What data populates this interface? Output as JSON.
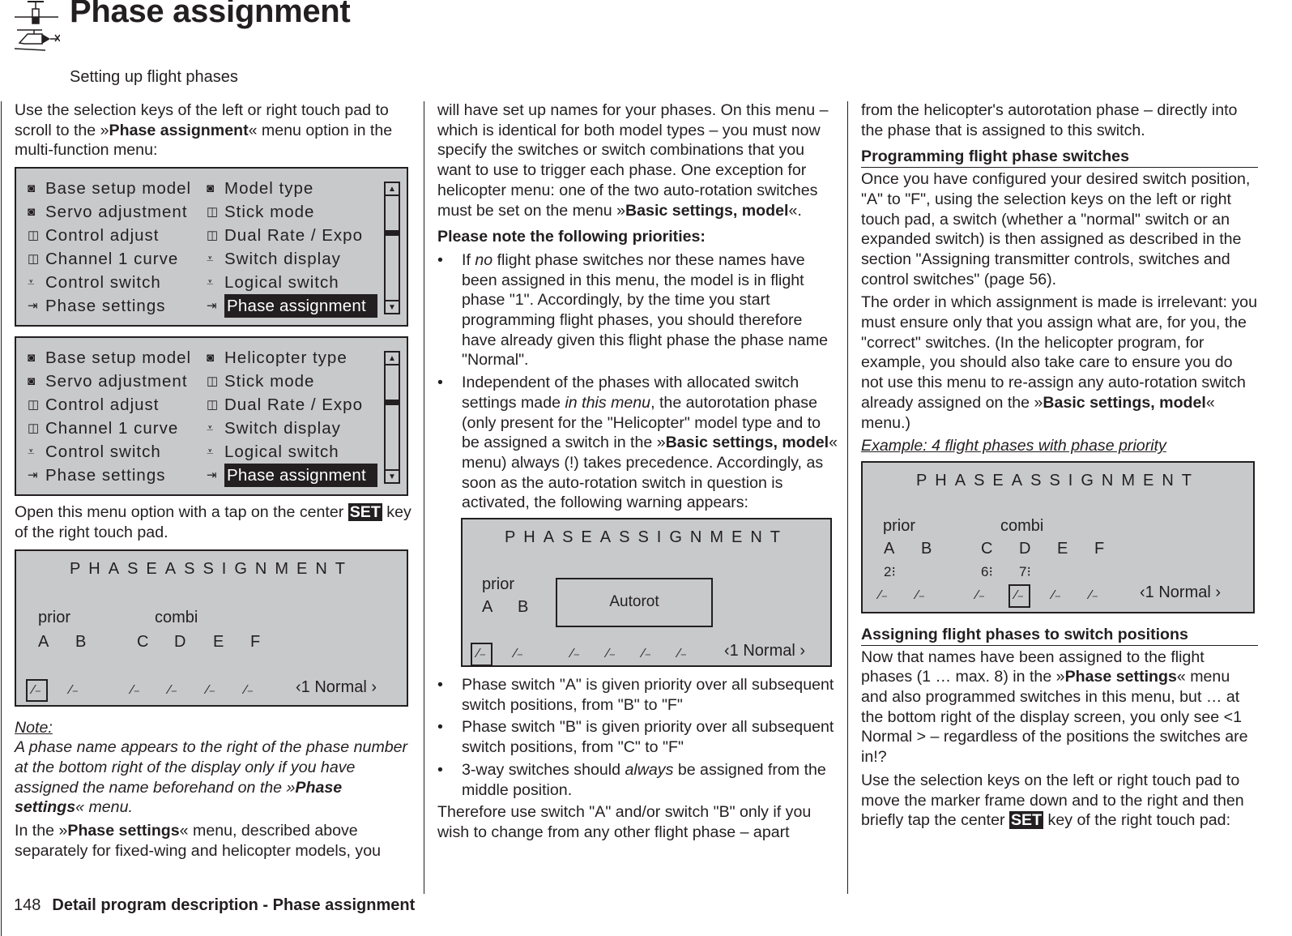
{
  "header": {
    "icon": "helicopter-airplane-icon",
    "title": "Phase assignment",
    "subtitle": "Setting up flight phases"
  },
  "col1": {
    "intro_a": "Use the selection keys of the left or right touch pad to scroll to the »",
    "intro_b": "Phase assignment",
    "intro_c": "« menu option in the multi-function menu:",
    "menu_fixed": {
      "items": [
        {
          "icon": "model-icon",
          "label": "Base setup model"
        },
        {
          "icon": "model-icon",
          "label": "Model type"
        },
        {
          "icon": "model-icon",
          "label": "Servo adjustment"
        },
        {
          "icon": "stick-icon",
          "label": "Stick mode"
        },
        {
          "icon": "stick-icon",
          "label": "Control adjust"
        },
        {
          "icon": "stick-icon",
          "label": "Dual Rate / Expo"
        },
        {
          "icon": "stick-icon",
          "label": "Channel 1 curve"
        },
        {
          "icon": "switch-icon",
          "label": "Switch display"
        },
        {
          "icon": "switch-icon",
          "label": "Control switch"
        },
        {
          "icon": "switch-icon",
          "label": "Logical switch"
        },
        {
          "icon": "phase-icon",
          "label": "Phase settings"
        },
        {
          "icon": "phase-icon",
          "label": "Phase assignment",
          "selected": true
        }
      ]
    },
    "menu_heli": {
      "items": [
        {
          "icon": "model-icon",
          "label": "Base setup model"
        },
        {
          "icon": "model-icon",
          "label": "Helicopter type"
        },
        {
          "icon": "model-icon",
          "label": "Servo adjustment"
        },
        {
          "icon": "stick-icon",
          "label": "Stick mode"
        },
        {
          "icon": "stick-icon",
          "label": "Control adjust"
        },
        {
          "icon": "stick-icon",
          "label": "Dual Rate / Expo"
        },
        {
          "icon": "stick-icon",
          "label": "Channel 1 curve"
        },
        {
          "icon": "switch-icon",
          "label": "Switch display"
        },
        {
          "icon": "switch-icon",
          "label": "Control switch"
        },
        {
          "icon": "switch-icon",
          "label": "Logical switch"
        },
        {
          "icon": "phase-icon",
          "label": "Phase settings"
        },
        {
          "icon": "phase-icon",
          "label": "Phase assignment",
          "selected": true
        }
      ]
    },
    "open_a": "Open this menu option with a tap on the center ",
    "open_key": "SET",
    "open_b": " key of the right touch pad.",
    "note_label": "Note:",
    "note_a": "A phase name appears to the right of the phase number at the bottom right of the display only if you have assigned the name beforehand on the »",
    "note_b": "Phase settings",
    "note_c": "« menu.",
    "in_a": "In the »",
    "in_b": "Phase settings",
    "in_c": "« menu, described above separately for fixed-wing and helicopter models, you"
  },
  "screen": {
    "title": "PHASEASSIGNMENT",
    "prior": "prior",
    "combi": "combi",
    "letters": [
      "A",
      "B",
      "C",
      "D",
      "E",
      "F"
    ],
    "phase": "‹1 Normal ›",
    "switch_glyph": "⁄₋",
    "popup": "Autorot",
    "assigned": [
      "2⁝",
      "",
      "6⁝",
      "7⁝",
      "",
      ""
    ]
  },
  "col2": {
    "p1": "will have set up names for your phases. On this menu – which is identical for both model types – you must now specify the switches or switch combinations that you want to use to trigger each phase. One exception for helicopter menu: one of the two auto-rotation switches must be set on the menu »",
    "p1_b": "Basic settings, model",
    "p1_c": "«.",
    "priorities": "Please note the following priorities:",
    "b1_a": "If ",
    "b1_i": "no",
    "b1_b": " flight phase switches nor these names have been assigned in this menu, the model is in flight phase \"1\". Accordingly, by the time you start programming flight phases, you should therefore have already given this flight phase the phase name \"Normal\".",
    "b2_a": "Independent of the phases with allocated switch settings made ",
    "b2_i": "in this menu",
    "b2_b": ", the autorotation phase (only present for the \"Helicopter\" model type and to be assigned a switch in the »",
    "b2_bold": "Basic settings, model",
    "b2_c": "« menu) always (!) takes precedence. Accordingly, as soon as the auto-rotation switch in question is activated, the following warning appears:",
    "b3": "Phase switch \"A\" is given priority over all subsequent switch positions, from \"B\" to \"F\"",
    "b4": "Phase switch \"B\" is given priority over all subsequent switch positions, from \"C\" to \"F\"",
    "b5_a": "3-way switches should ",
    "b5_i": "always",
    "b5_b": " be assigned from the middle position.",
    "p_end": "Therefore use switch \"A\" and/or switch \"B\" only if you wish to change from any other flight phase – apart"
  },
  "col3": {
    "p1": "from the helicopter's autorotation phase – directly into the phase that is assigned to this switch.",
    "h1": "Programming flight phase switches",
    "p2": "Once you have configured your desired switch position, \"A\" to \"F\", using the selection keys on the left or right touch pad, a switch (whether a \"normal\" switch or an expanded switch) is then assigned as described in the section \"Assigning transmitter controls, switches and control switches\" (page 56).",
    "p3_a": "The order in which assignment is made is irrelevant: you must ensure only that you assign what are, for you, the \"correct\" switches. (In the helicopter program, for example, you should also take care to ensure you do not use this menu to re-assign any auto-rotation switch already assigned on the »",
    "p3_b": "Basic settings, model",
    "p3_c": "« menu.)",
    "example": "Example: 4 flight phases with phase priority",
    "h2": "Assigning flight phases to switch positions",
    "p4_a": "Now that names have been assigned to the flight phases (1 … max. 8) in the »",
    "p4_b": "Phase settings",
    "p4_c": "« menu and also programmed switches in this menu, but … at the bottom right of the display screen, you only see <1 Normal > – regardless of the positions the switches are in!?",
    "p5_a": "Use the selection keys on the left or right touch pad to move the marker frame down and to the right and then briefly tap the center ",
    "p5_key": "SET",
    "p5_b": " key of the right touch pad:"
  },
  "footer": {
    "page": "148",
    "section": "Detail program description - Phase assignment"
  }
}
